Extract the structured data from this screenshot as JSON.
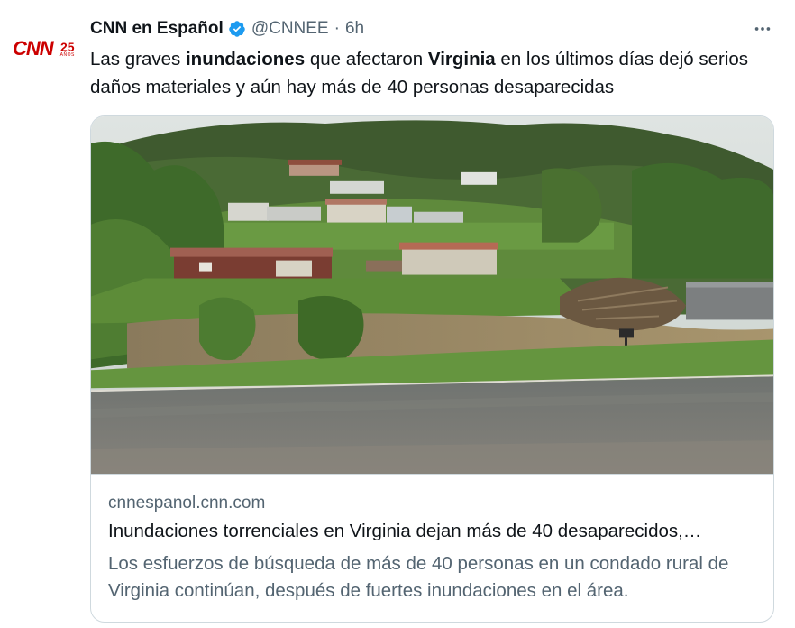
{
  "tweet": {
    "author": {
      "display_name": "CNN en Español",
      "handle": "@CNNEE",
      "verified": true,
      "avatar_logo_text": "CNN",
      "avatar_badge_number": "25",
      "avatar_badge_subtext": "AÑOS"
    },
    "separator": "·",
    "timestamp": "6h",
    "more_icon": "ellipsis-icon",
    "text_parts": [
      {
        "text": "Las graves ",
        "bold": false
      },
      {
        "text": "inundaciones",
        "bold": true
      },
      {
        "text": " que afectaron ",
        "bold": false
      },
      {
        "text": "Virginia",
        "bold": true
      },
      {
        "text": " en los últimos días dejó serios daños materiales y aún hay más de 40 personas desaparecidas",
        "bold": false
      }
    ],
    "card": {
      "domain": "cnnespanol.cnn.com",
      "title": "Inundaciones torrenciales en Virginia dejan más de 40 desaparecidos,…",
      "description": "Los esfuerzos de búsqueda de más de 40 personas en un condado rural de Virginia continúan, después de fuertes inundaciones en el área."
    }
  },
  "colors": {
    "text_primary": "#0f1419",
    "text_secondary": "#536471",
    "verified_blue": "#1d9bf0",
    "border": "#cfd9de",
    "cnn_red": "#cc0000"
  }
}
